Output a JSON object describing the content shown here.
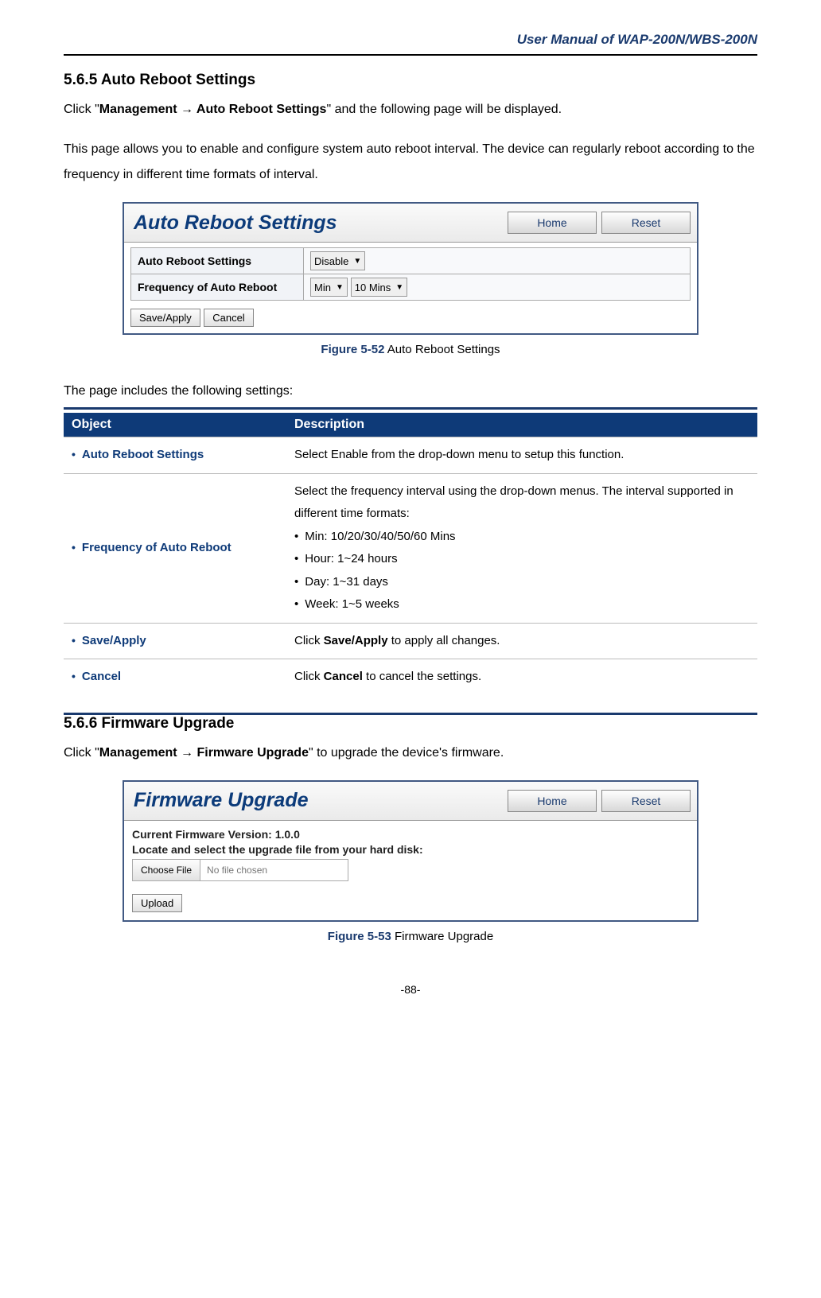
{
  "header": {
    "title": "User Manual of WAP-200N/WBS-200N"
  },
  "section1": {
    "heading": "5.6.5   Auto Reboot Settings",
    "intro_pre": "Click \"",
    "intro_bold": "Management → Auto Reboot Settings",
    "intro_post": "\" and the following page will be displayed.",
    "desc": "This page allows you to enable and configure system auto reboot interval. The device can regularly reboot according to the frequency in different time formats of interval."
  },
  "fig1": {
    "title": "Auto Reboot Settings",
    "btn_home": "Home",
    "btn_reset": "Reset",
    "row1_label": "Auto Reboot Settings",
    "row1_value": "Disable",
    "row2_label": "Frequency of Auto Reboot",
    "row2_val1": "Min",
    "row2_val2": "10 Mins",
    "btn_save": "Save/Apply",
    "btn_cancel": "Cancel",
    "caption_num": "Figure 5-52",
    "caption_text": " Auto Reboot Settings"
  },
  "table_intro": "The page includes the following settings:",
  "table": {
    "h_object": "Object",
    "h_desc": "Description",
    "rows": [
      {
        "obj": "Auto Reboot Settings",
        "desc": "Select Enable from the drop-down menu to setup this function."
      },
      {
        "obj": "Frequency of Auto Reboot",
        "desc_intro": "Select the frequency interval using the drop-down menus. The interval supported in different time formats:",
        "items": [
          "Min: 10/20/30/40/50/60 Mins",
          "Hour: 1~24 hours",
          "Day: 1~31 days",
          "Week: 1~5 weeks"
        ]
      },
      {
        "obj": "Save/Apply",
        "desc_pre": "Click ",
        "desc_bold": "Save/Apply",
        "desc_post": " to apply all changes."
      },
      {
        "obj": "Cancel",
        "desc_pre": "Click ",
        "desc_bold": "Cancel",
        "desc_post": " to cancel the settings."
      }
    ]
  },
  "section2": {
    "heading": "5.6.6   Firmware Upgrade",
    "intro_pre": "Click \"",
    "intro_bold": "Management → Firmware Upgrade",
    "intro_post": "\" to upgrade the device's firmware."
  },
  "fig2": {
    "title": "Firmware Upgrade",
    "btn_home": "Home",
    "btn_reset": "Reset",
    "version": "Current Firmware Version: 1.0.0",
    "locate": "Locate and select the upgrade file from your hard disk:",
    "btn_choose": "Choose File",
    "nofile": "No file chosen",
    "btn_upload": "Upload",
    "caption_num": "Figure 5-53",
    "caption_text": " Firmware Upgrade"
  },
  "page_number": "-88-"
}
